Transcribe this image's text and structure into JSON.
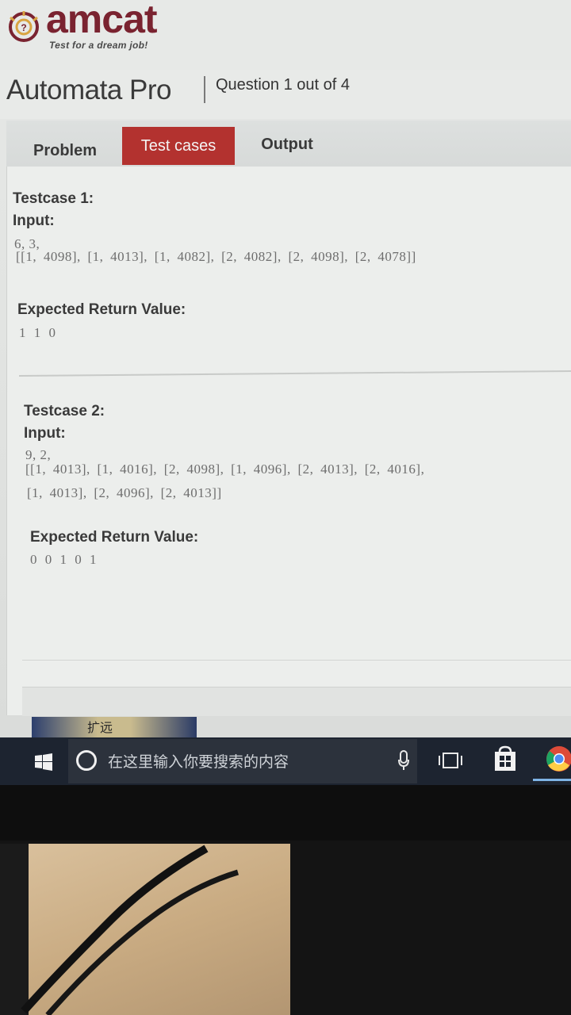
{
  "logo": {
    "wordmark": "amcat",
    "tagline": "Test for a dream job!"
  },
  "header": {
    "app_title": "Automata Pro",
    "question_count": "Question 1 out of 4"
  },
  "tabs": [
    {
      "label": "Problem",
      "active": false
    },
    {
      "label": "Test cases",
      "active": true
    },
    {
      "label": "Output",
      "active": false
    }
  ],
  "testcases": [
    {
      "title": "Testcase 1:",
      "input_label": "Input:",
      "input_lines": [
        "6, 3,",
        "[[1, 4098], [1, 4013], [1, 4082], [2, 4082], [2, 4098], [2, 4078]]"
      ],
      "expected_label": "Expected Return Value:",
      "expected_value": "1 1 0"
    },
    {
      "title": "Testcase 2:",
      "input_label": "Input:",
      "input_lines": [
        "9, 2,",
        "[[1, 4013], [1, 4016], [2, 4098], [1, 4096], [2, 4013], [2, 4016],",
        "[1, 4013], [2, 4096], [2, 4013]]"
      ],
      "expected_label": "Expected Return Value:",
      "expected_value": "0 0 1 0 1"
    }
  ],
  "taskbar": {
    "search_placeholder": "在这里输入你要搜索的内容",
    "background_window_text": "扩远"
  },
  "colors": {
    "brand": "#7a2330",
    "active_tab": "#b3322f",
    "taskbar": "#1d2430"
  },
  "icons": [
    "windows-start-icon",
    "cortana-icon",
    "microphone-icon",
    "task-view-icon",
    "store-icon",
    "chrome-icon"
  ]
}
